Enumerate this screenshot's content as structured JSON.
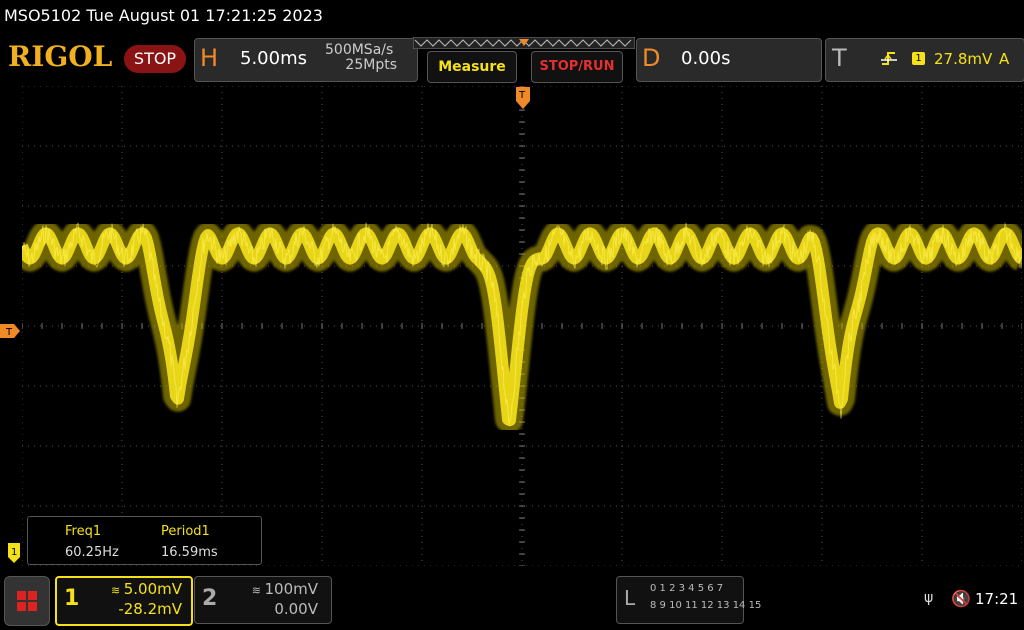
{
  "header": {
    "title": "MSO5102  Tue August 01 17:21:25 2023",
    "logo": "RIGOL",
    "run_state": "STOP"
  },
  "horizontal": {
    "letter": "H",
    "time_per_div": "5.00ms",
    "sample_rate": "500MSa/s",
    "memory_depth": "25Mpts"
  },
  "buttons": {
    "measure": "Measure",
    "stop_run": "STOP/RUN"
  },
  "delay": {
    "letter": "D",
    "value": "0.00s"
  },
  "trigger": {
    "letter": "T",
    "source_channel": "1",
    "level": "27.8mV",
    "mode": "A"
  },
  "markers": {
    "trigger_left": "T",
    "channel1_left": "1"
  },
  "measurements": [
    {
      "label": "Freq1",
      "value": "60.25Hz"
    },
    {
      "label": "Period1",
      "value": "16.59ms"
    }
  ],
  "channels": [
    {
      "number": "1",
      "scale": "5.00mV",
      "offset": "-28.2mV",
      "active": true
    },
    {
      "number": "2",
      "scale": "100mV",
      "offset": "0.00V",
      "active": false
    }
  ],
  "logic_analyzer": {
    "letter": "L",
    "row1": "0 1 2 3   4 5 6 7",
    "row2": "8 9 10 11  12 13 14 15"
  },
  "status": {
    "clock": "17:21"
  },
  "colors": {
    "channel1": "#f5e11a",
    "accent_orange": "#f08a28",
    "stop_red": "#8a1414",
    "logo_gold": "#f0b020"
  },
  "icons": {
    "menu": "grid-menu-icon",
    "usb": "usb-icon",
    "sound": "speaker-muted-icon",
    "trigger_edge": "rising-edge-icon"
  }
}
